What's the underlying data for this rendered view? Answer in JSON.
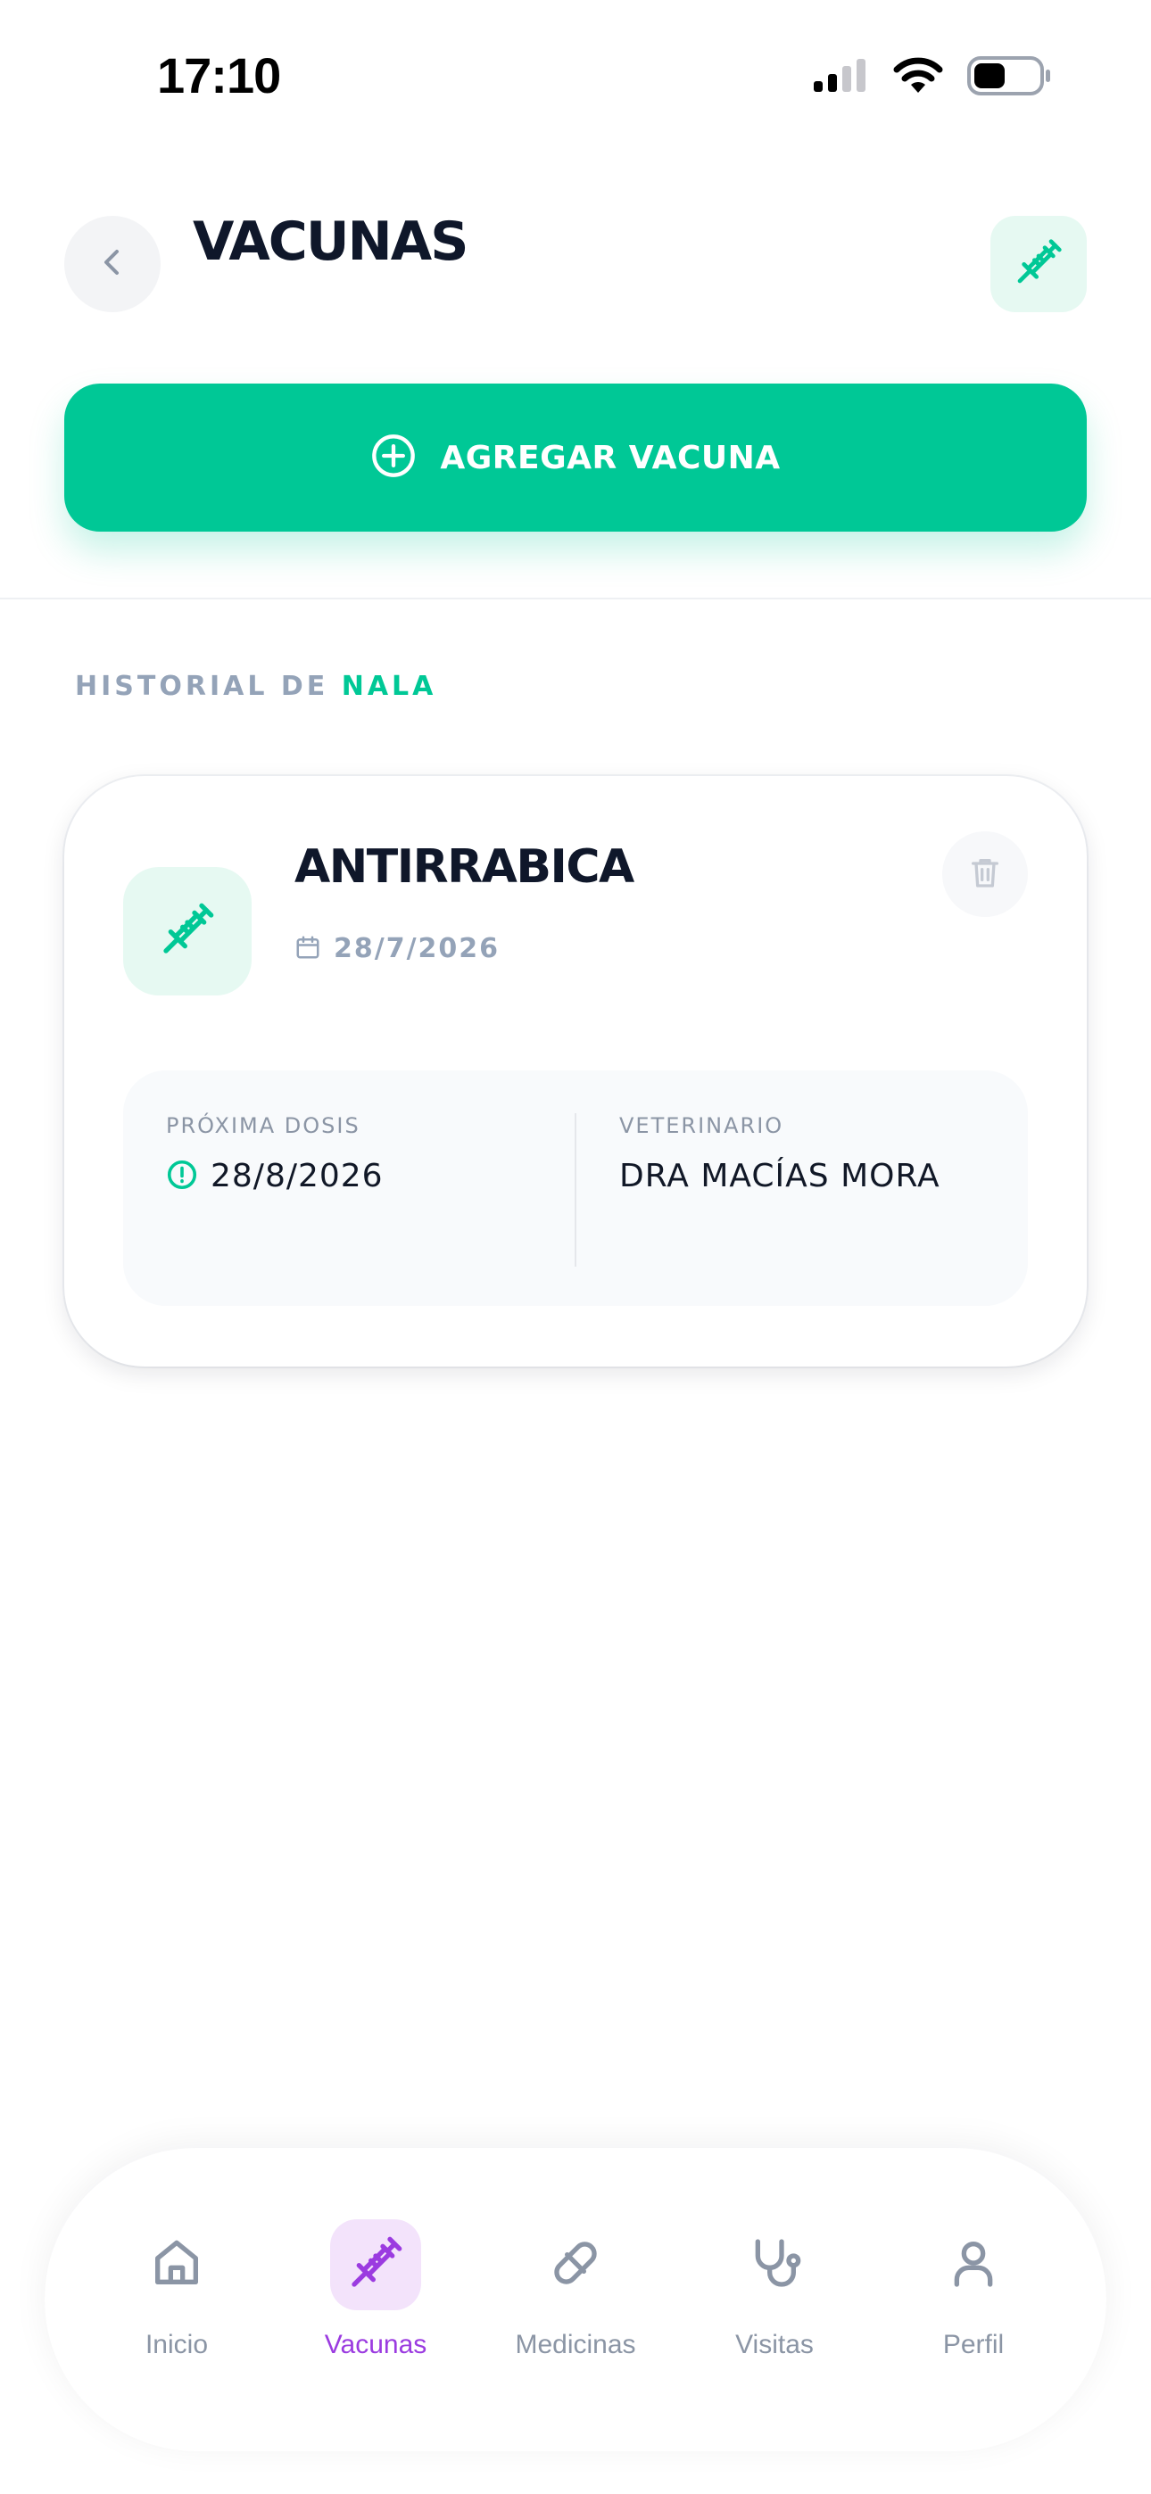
{
  "status_bar": {
    "time": "17:10",
    "icons": [
      "cellular-signal-icon",
      "wifi-icon",
      "battery-icon"
    ]
  },
  "header": {
    "title": "VACUNAS",
    "back_icon": "chevron-left-icon",
    "action_icon": "syringe-icon"
  },
  "actions": {
    "add_label": "AGREGAR VACUNA",
    "add_icon": "plus-circle-icon"
  },
  "history": {
    "prefix": "HISTORIAL DE ",
    "pet_name": "NALA"
  },
  "vaccines": [
    {
      "name": "ANTIRRABICA",
      "date": "28/7/2026",
      "next_dose_label": "PRÓXIMA DOSIS",
      "next_dose": "28/8/2026",
      "vet_label": "VETERINARIO",
      "vet": "DRA MACÍAS MORA"
    }
  ],
  "bottom_nav": {
    "items": [
      {
        "label": "Inicio",
        "icon": "home-icon",
        "active": false
      },
      {
        "label": "Vacunas",
        "icon": "syringe-icon",
        "active": true
      },
      {
        "label": "Medicinas",
        "icon": "pill-icon",
        "active": false
      },
      {
        "label": "Visitas",
        "icon": "stethoscope-icon",
        "active": false
      },
      {
        "label": "Perfil",
        "icon": "user-icon",
        "active": false
      }
    ]
  },
  "colors": {
    "accent": "#00c896",
    "accent_soft": "#e6f9f2",
    "nav_active": "#9b3be0",
    "nav_active_bg": "#f3e3fb",
    "muted": "#94a3b8",
    "text": "#0f172a"
  }
}
